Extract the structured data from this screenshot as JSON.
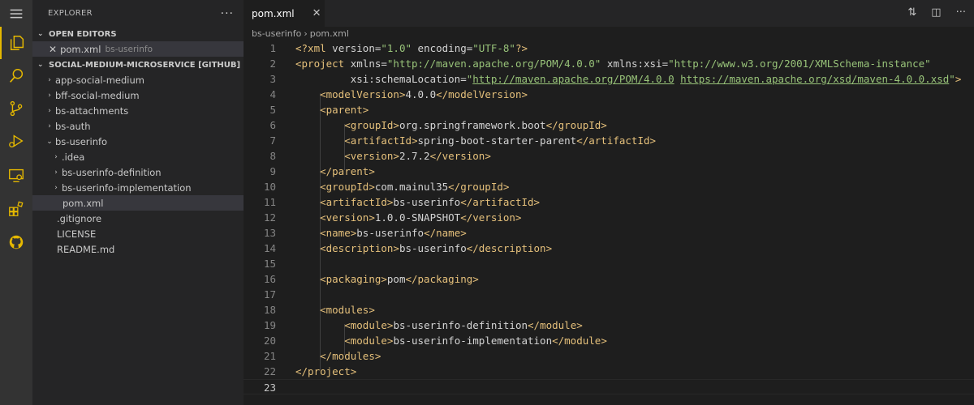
{
  "sidebar": {
    "title": "EXPLORER",
    "more": "···",
    "open_editors": {
      "label": "OPEN EDITORS",
      "file": "pom.xml",
      "folder": "bs-userinfo"
    },
    "project": {
      "label": "SOCIAL-MEDIUM-MICROSERVICE [GITHUB]",
      "items": [
        {
          "label": "app-social-medium",
          "type": "folder"
        },
        {
          "label": "bff-social-medium",
          "type": "folder"
        },
        {
          "label": "bs-attachments",
          "type": "folder"
        },
        {
          "label": "bs-auth",
          "type": "folder"
        },
        {
          "label": "bs-userinfo",
          "type": "folder-open"
        },
        {
          "label": ".idea",
          "type": "folder"
        },
        {
          "label": "bs-userinfo-definition",
          "type": "folder"
        },
        {
          "label": "bs-userinfo-implementation",
          "type": "folder"
        },
        {
          "label": "pom.xml",
          "type": "file"
        },
        {
          "label": ".gitignore",
          "type": "file"
        },
        {
          "label": "LICENSE",
          "type": "file"
        },
        {
          "label": "README.md",
          "type": "file"
        }
      ]
    }
  },
  "tab": {
    "label": "pom.xml",
    "close": "✕"
  },
  "breadcrumb": {
    "folder": "bs-userinfo",
    "sep": "›",
    "file": "pom.xml"
  },
  "editor": {
    "current_line": 23,
    "lines": [
      {
        "n": "1",
        "segs": [
          [
            "t",
            "<?xml"
          ],
          [
            "a",
            " version="
          ],
          [
            "s",
            "\"1.0\""
          ],
          [
            "a",
            " encoding="
          ],
          [
            "s",
            "\"UTF-8\""
          ],
          [
            "t",
            "?>"
          ]
        ]
      },
      {
        "n": "2",
        "segs": [
          [
            "t",
            "<project"
          ],
          [
            "a",
            " xmlns="
          ],
          [
            "s",
            "\"http://maven.apache.org/POM/4.0.0\""
          ],
          [
            "a",
            " xmlns:xsi="
          ],
          [
            "s",
            "\"http://www.w3.org/2001/XMLSchema-instance\""
          ]
        ]
      },
      {
        "n": "3",
        "segs": [
          [
            "a",
            "         xsi:schemaLocation="
          ],
          [
            "s",
            "\""
          ],
          [
            "u",
            "http://maven.apache.org/POM/4.0.0"
          ],
          [
            "a",
            " "
          ],
          [
            "u",
            "https://maven.apache.org/xsd/maven-4.0.0.xsd"
          ],
          [
            "s",
            "\""
          ],
          [
            "t",
            ">"
          ]
        ]
      },
      {
        "n": "4",
        "segs": [
          [
            "p",
            "    "
          ],
          [
            "t",
            "<modelVersion>"
          ],
          [
            "x",
            "4.0.0"
          ],
          [
            "t",
            "</modelVersion>"
          ]
        ]
      },
      {
        "n": "5",
        "segs": [
          [
            "p",
            "    "
          ],
          [
            "t",
            "<parent>"
          ]
        ]
      },
      {
        "n": "6",
        "segs": [
          [
            "p",
            "        "
          ],
          [
            "t",
            "<groupId>"
          ],
          [
            "x",
            "org.springframework.boot"
          ],
          [
            "t",
            "</groupId>"
          ]
        ]
      },
      {
        "n": "7",
        "segs": [
          [
            "p",
            "        "
          ],
          [
            "t",
            "<artifactId>"
          ],
          [
            "x",
            "spring-boot-starter-parent"
          ],
          [
            "t",
            "</artifactId>"
          ]
        ]
      },
      {
        "n": "8",
        "segs": [
          [
            "p",
            "        "
          ],
          [
            "t",
            "<version>"
          ],
          [
            "x",
            "2.7.2"
          ],
          [
            "t",
            "</version>"
          ]
        ]
      },
      {
        "n": "9",
        "segs": [
          [
            "p",
            "    "
          ],
          [
            "t",
            "</parent>"
          ]
        ]
      },
      {
        "n": "10",
        "segs": [
          [
            "p",
            "    "
          ],
          [
            "t",
            "<groupId>"
          ],
          [
            "x",
            "com.mainul35"
          ],
          [
            "t",
            "</groupId>"
          ]
        ]
      },
      {
        "n": "11",
        "segs": [
          [
            "p",
            "    "
          ],
          [
            "t",
            "<artifactId>"
          ],
          [
            "x",
            "bs-userinfo"
          ],
          [
            "t",
            "</artifactId>"
          ]
        ]
      },
      {
        "n": "12",
        "segs": [
          [
            "p",
            "    "
          ],
          [
            "t",
            "<version>"
          ],
          [
            "x",
            "1.0.0-SNAPSHOT"
          ],
          [
            "t",
            "</version>"
          ]
        ]
      },
      {
        "n": "13",
        "segs": [
          [
            "p",
            "    "
          ],
          [
            "t",
            "<name>"
          ],
          [
            "x",
            "bs-userinfo"
          ],
          [
            "t",
            "</name>"
          ]
        ]
      },
      {
        "n": "14",
        "segs": [
          [
            "p",
            "    "
          ],
          [
            "t",
            "<description>"
          ],
          [
            "x",
            "bs-userinfo"
          ],
          [
            "t",
            "</description>"
          ]
        ]
      },
      {
        "n": "15",
        "segs": []
      },
      {
        "n": "16",
        "segs": [
          [
            "p",
            "    "
          ],
          [
            "t",
            "<packaging>"
          ],
          [
            "x",
            "pom"
          ],
          [
            "t",
            "</packaging>"
          ]
        ]
      },
      {
        "n": "17",
        "segs": []
      },
      {
        "n": "18",
        "segs": [
          [
            "p",
            "    "
          ],
          [
            "t",
            "<modules>"
          ]
        ]
      },
      {
        "n": "19",
        "segs": [
          [
            "p",
            "        "
          ],
          [
            "t",
            "<module>"
          ],
          [
            "x",
            "bs-userinfo-definition"
          ],
          [
            "t",
            "</module>"
          ]
        ]
      },
      {
        "n": "20",
        "segs": [
          [
            "p",
            "        "
          ],
          [
            "t",
            "<module>"
          ],
          [
            "x",
            "bs-userinfo-implementation"
          ],
          [
            "t",
            "</module>"
          ]
        ]
      },
      {
        "n": "21",
        "segs": [
          [
            "p",
            "    "
          ],
          [
            "t",
            "</modules>"
          ]
        ]
      },
      {
        "n": "22",
        "segs": [
          [
            "t",
            "</project>"
          ]
        ]
      },
      {
        "n": "23",
        "segs": []
      }
    ]
  }
}
